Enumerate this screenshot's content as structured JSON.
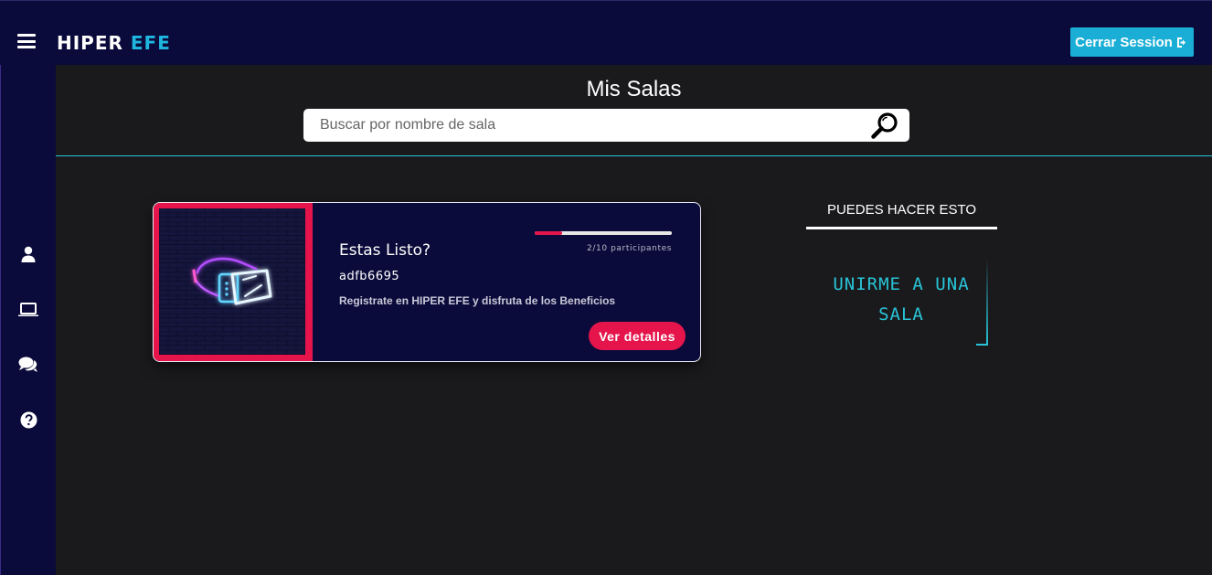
{
  "header": {
    "logo_main": "HIPER",
    "logo_accent": "EFE",
    "logout_label": "Cerrar Session"
  },
  "page": {
    "title": "Mis Salas",
    "search_placeholder": "Buscar por nombre de sala"
  },
  "sidebar": {
    "icons": [
      "menu-icon",
      "user-icon",
      "laptop-icon",
      "comments-icon",
      "question-icon"
    ]
  },
  "room_card": {
    "title": "Estas Listo?",
    "code": "adfb6695",
    "description": "Registrate en HIPER EFE y disfruta de los Beneficios",
    "participants_text": "2/10 participantes",
    "participants_current": 2,
    "participants_max": 10,
    "details_label": "Ver detalles"
  },
  "right_panel": {
    "heading": "PUEDES HACER ESTO",
    "join_line1": "UNIRME A UNA",
    "join_line2": "SALA"
  },
  "colors": {
    "navy": "#0b0b3b",
    "background": "#1a1a1d",
    "accent_cyan": "#28c4d6",
    "button_blue": "#1aaed6",
    "accent_red": "#e5154b"
  }
}
